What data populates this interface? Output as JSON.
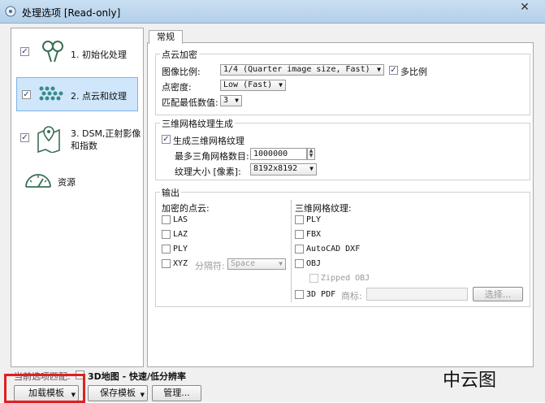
{
  "window": {
    "title": "处理选项 [Read-only]",
    "close": "✕"
  },
  "sidebar": {
    "items": [
      {
        "label_line1": "1. 初始化处理",
        "checked": true,
        "icon": "init-processing-icon"
      },
      {
        "label_line1": "2. 点云和纹理",
        "checked": true,
        "icon": "point-cloud-icon"
      },
      {
        "label_line1": "3. DSM,正射影像",
        "label_line2": "和指数",
        "checked": true,
        "icon": "map-marker-icon"
      },
      {
        "label_line1": "资源",
        "icon": "gauge-icon"
      }
    ]
  },
  "tabs": [
    {
      "label": "常规"
    }
  ],
  "point_cloud": {
    "title": "点云加密",
    "image_scale_label": "图像比例:",
    "image_scale_value": "1/4 (Quarter image size, Fast)",
    "multi_scale_label": "多比例",
    "density_label": "点密度:",
    "density_value": "Low (Fast)",
    "min_matches_label": "匹配最低数值:",
    "min_matches_value": "3"
  },
  "mesh": {
    "title": "三维网格纹理生成",
    "generate_label": "生成三维网格纹理",
    "max_triangles_label": "最多三角网格数目:",
    "max_triangles_value": "1000000",
    "texture_size_label": "纹理大小 [像素]:",
    "texture_size_value": "8192x8192"
  },
  "output": {
    "title": "输出",
    "dense_title": "加密的点云:",
    "dense": [
      "LAS",
      "LAZ",
      "PLY",
      "XYZ"
    ],
    "delimiter_label": "分隔符:",
    "delimiter_value": "Space",
    "mesh_title": "三维网格纹理:",
    "mesh": [
      "PLY",
      "FBX",
      "AutoCAD DXF",
      "OBJ"
    ],
    "zipped_obj": "Zipped OBJ",
    "pdf": "3D PDF",
    "logo_label": "商标:",
    "select_button": "选择..."
  },
  "footer": {
    "current_template_prefix": "当前选项匹配:",
    "current_template": "3D地图 - 快速/低分辨率",
    "load_template": "加载模板",
    "save_template": "保存模板",
    "manage": "管理..."
  },
  "watermark": "中云图"
}
